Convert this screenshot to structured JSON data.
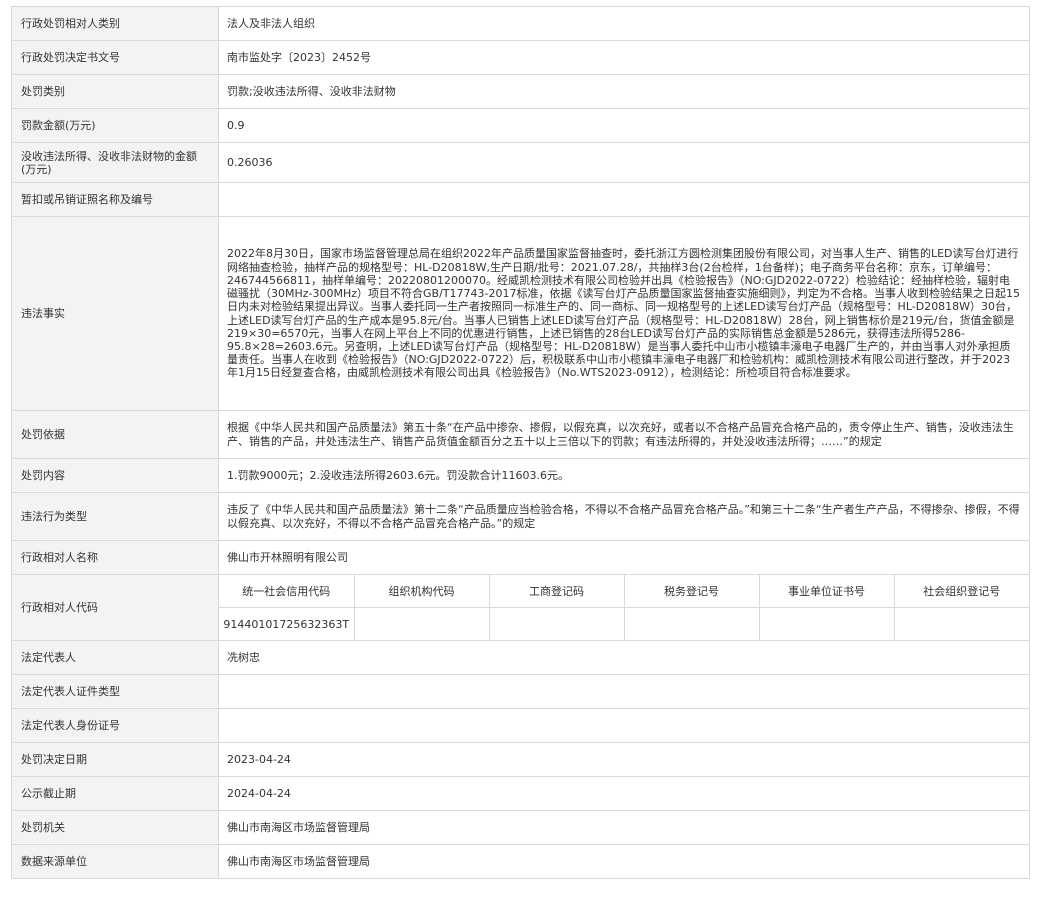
{
  "rows": [
    {
      "label": "行政处罚相对人类别",
      "value": "法人及非法人组织"
    },
    {
      "label": "行政处罚决定书文号",
      "value": "南市监处字〔2023〕2452号"
    },
    {
      "label": "处罚类别",
      "value": "罚款;没收违法所得、没收非法财物"
    },
    {
      "label": "罚款金额(万元)",
      "value": "0.9"
    },
    {
      "label": "没收违法所得、没收非法财物的金额(万元)",
      "value": "0.26036"
    },
    {
      "label": "暂扣或吊销证照名称及编号",
      "value": ""
    },
    {
      "label": "违法事实",
      "value": "2022年8月30日，国家市场监督管理总局在组织2022年产品质量国家监督抽查时，委托浙江方圆检测集团股份有限公司，对当事人生产、销售的LED读写台灯进行网络抽查检验，抽样产品的规格型号：HL-D20818W,生产日期/批号：2021.07.28/，共抽样3台(2台检样，1台备样)；电子商务平台名称：京东，订单编号：246744566811，抽样单编号：20220801200070。经威凯检测技术有限公司检验并出具《检验报告》（NO:GJD2022-0722）检验结论：经抽样检验，辐射电磁骚扰（30MHz-300MHz）项目不符合GB/T17743-2017标准，依据《读写台灯产品质量国家监督抽查实施细则》，判定为不合格。当事人收到检验结果之日起15日内未对检验结果提出异议。当事人委托同一生产者按照同一标准生产的、同一商标、同一规格型号的上述LED读写台灯产品（规格型号：HL-D20818W）30台，上述LED读写台灯产品的生产成本是95.8元/台。当事人已销售上述LED读写台灯产品（规格型号：HL-D20818W）28台，网上销售标价是219元/台，货值金额是219×30=6570元，当事人在网上平台上不同的优惠进行销售，上述已销售的28台LED读写台灯产品的实际销售总金额是5286元，获得违法所得5286-95.8×28=2603.6元。另查明，上述LED读写台灯产品（规格型号：HL-D20818W）是当事人委托中山市小榄镇丰濠电子电器厂生产的，并由当事人对外承担质量责任。当事人在收到《检验报告》（NO:GJD2022-0722）后，积极联系中山市小榄镇丰濠电子电器厂和检验机构：威凯检测技术有限公司进行整改，并于2023年1月15日经复查合格，由威凯检测技术有限公司出具《检验报告》（No.WTS2023-0912），检测结论：所检项目符合标准要求。"
    },
    {
      "label": "处罚依据",
      "value": "根据《中华人民共和国产品质量法》第五十条“在产品中掺杂、掺假，以假充真，以次充好，或者以不合格产品冒充合格产品的，责令停止生产、销售，没收违法生产、销售的产品，并处违法生产、销售产品货值金额百分之五十以上三倍以下的罚款；有违法所得的，并处没收违法所得；……”的规定"
    },
    {
      "label": "处罚内容",
      "value": "1.罚款9000元；2.没收违法所得2603.6元。罚没款合计11603.6元。"
    },
    {
      "label": "违法行为类型",
      "value": "违反了《中华人民共和国产品质量法》第十二条“产品质量应当检验合格，不得以不合格产品冒充合格产品。”和第三十二条“生产者生产产品，不得掺杂、掺假，不得以假充真、以次充好，不得以不合格产品冒充合格产品。”的规定"
    },
    {
      "label": "行政相对人名称",
      "value": "佛山市开林照明有限公司"
    }
  ],
  "code_row": {
    "label": "行政相对人代码",
    "headers": [
      "统一社会信用代码",
      "组织机构代码",
      "工商登记码",
      "税务登记号",
      "事业单位证书号",
      "社会组织登记号"
    ],
    "values": [
      "91440101725632363T",
      "",
      "",
      "",
      "",
      ""
    ]
  },
  "rows2": [
    {
      "label": "法定代表人",
      "value": "冼树忠"
    },
    {
      "label": "法定代表人证件类型",
      "value": ""
    },
    {
      "label": "法定代表人身份证号",
      "value": ""
    },
    {
      "label": "处罚决定日期",
      "value": "2023-04-24"
    },
    {
      "label": "公示截止期",
      "value": "2024-04-24"
    },
    {
      "label": "处罚机关",
      "value": "佛山市南海区市场监督管理局"
    },
    {
      "label": "数据来源单位",
      "value": "佛山市南海区市场监督管理局"
    }
  ]
}
